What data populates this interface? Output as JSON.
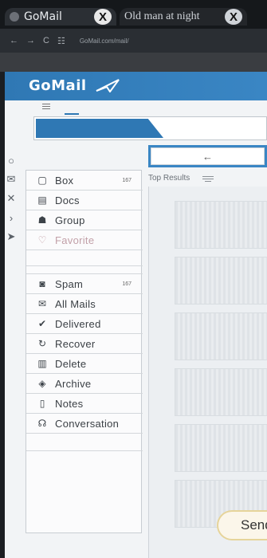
{
  "browser": {
    "tabs": [
      {
        "title": "GoMail",
        "close": "X",
        "active": true
      },
      {
        "title": "Old man at night",
        "close": "X",
        "active": false
      }
    ],
    "nav": {
      "back": "←",
      "forward": "→",
      "reload": "C"
    },
    "url": "GoMail.com/mail/"
  },
  "app": {
    "brand": "GoMail",
    "back_arrow": "←",
    "results_label": "Top Results",
    "send_label": "Send"
  },
  "rail_icons": [
    "circle-icon",
    "mail-icon",
    "scissors-icon",
    "chevron-right-icon",
    "paper-plane-icon"
  ],
  "folders_top": [
    {
      "label": "Box",
      "count": "167",
      "icon": "inbox-icon"
    },
    {
      "label": "Docs",
      "count": "",
      "icon": "docs-icon"
    },
    {
      "label": "Group",
      "count": "",
      "icon": "group-icon"
    },
    {
      "label": "Favorite",
      "count": "",
      "icon": "heart-icon"
    }
  ],
  "folders_bottom": [
    {
      "label": "Spam",
      "count": "167",
      "icon": "spam-icon"
    },
    {
      "label": "All Mails",
      "count": "",
      "icon": "mail-icon"
    },
    {
      "label": "Delivered",
      "count": "",
      "icon": "check-icon"
    },
    {
      "label": "Recover",
      "count": "",
      "icon": "recover-icon"
    },
    {
      "label": "Delete",
      "count": "",
      "icon": "trash-icon"
    },
    {
      "label": "Archive",
      "count": "",
      "icon": "archive-icon"
    },
    {
      "label": "Notes",
      "count": "",
      "icon": "note-icon"
    },
    {
      "label": "Conversation",
      "count": "",
      "icon": "conversation-icon"
    }
  ],
  "colors": {
    "brand": "#2f78b4",
    "accent": "#3a86c4"
  }
}
